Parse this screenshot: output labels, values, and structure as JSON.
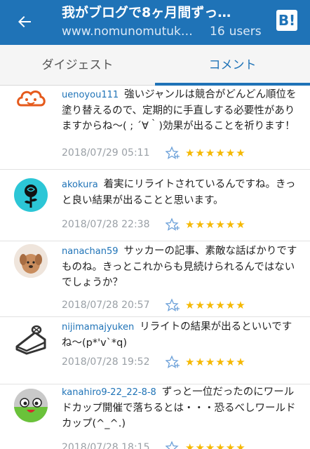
{
  "header": {
    "title": "我がブログで8ヶ月間ずっ…",
    "url": "www.nomunomutuk…",
    "users_count": "16",
    "users_label": "users",
    "hatena_label": "B!"
  },
  "tabs": [
    {
      "label": "ダイジェスト",
      "active": false
    },
    {
      "label": "コメント",
      "active": true
    }
  ],
  "comments": [
    {
      "user": "uenoyou111",
      "text": "強いジャンルは競合がどんどん順位を塗り替えるので、定期的に手直しする必要性がありますからね〜( ; ´∀｀)効果が出ることを祈ります！",
      "date": "2018/07/29 05:11",
      "stars": "★★★★★★",
      "star_count": 6
    },
    {
      "user": "akokura",
      "text": "着実にリライトされているんですね。きっと良い結果が出ることと思います。",
      "date": "2018/07/28 22:38",
      "stars": "★★★★★★",
      "star_count": 6
    },
    {
      "user": "nanachan59",
      "text": "サッカーの記事、素敵な話ばかりですものね。きっとこれからも見続けられるんではないでしょうか？",
      "date": "2018/07/28 20:57",
      "stars": "★★★★★★",
      "star_count": 6
    },
    {
      "user": "nijimamajyuken",
      "text": "リライトの結果が出るといいですね〜(p*'v`*q)",
      "date": "2018/07/28 19:52",
      "stars": "★★★★★★",
      "star_count": 6
    },
    {
      "user": "kanahiro9-22_22-8-8",
      "text": "ずっと一位だったのにワールドカップ開催で落ちるとは・・・恐るべしワールドカップ(^_^.)",
      "date": "2018/07/28 18:15",
      "stars": "★★★★★★",
      "star_count": 6
    }
  ],
  "colors": {
    "accent": "#1f73b7",
    "star": "#f5b800",
    "date": "#9aa0a6"
  }
}
